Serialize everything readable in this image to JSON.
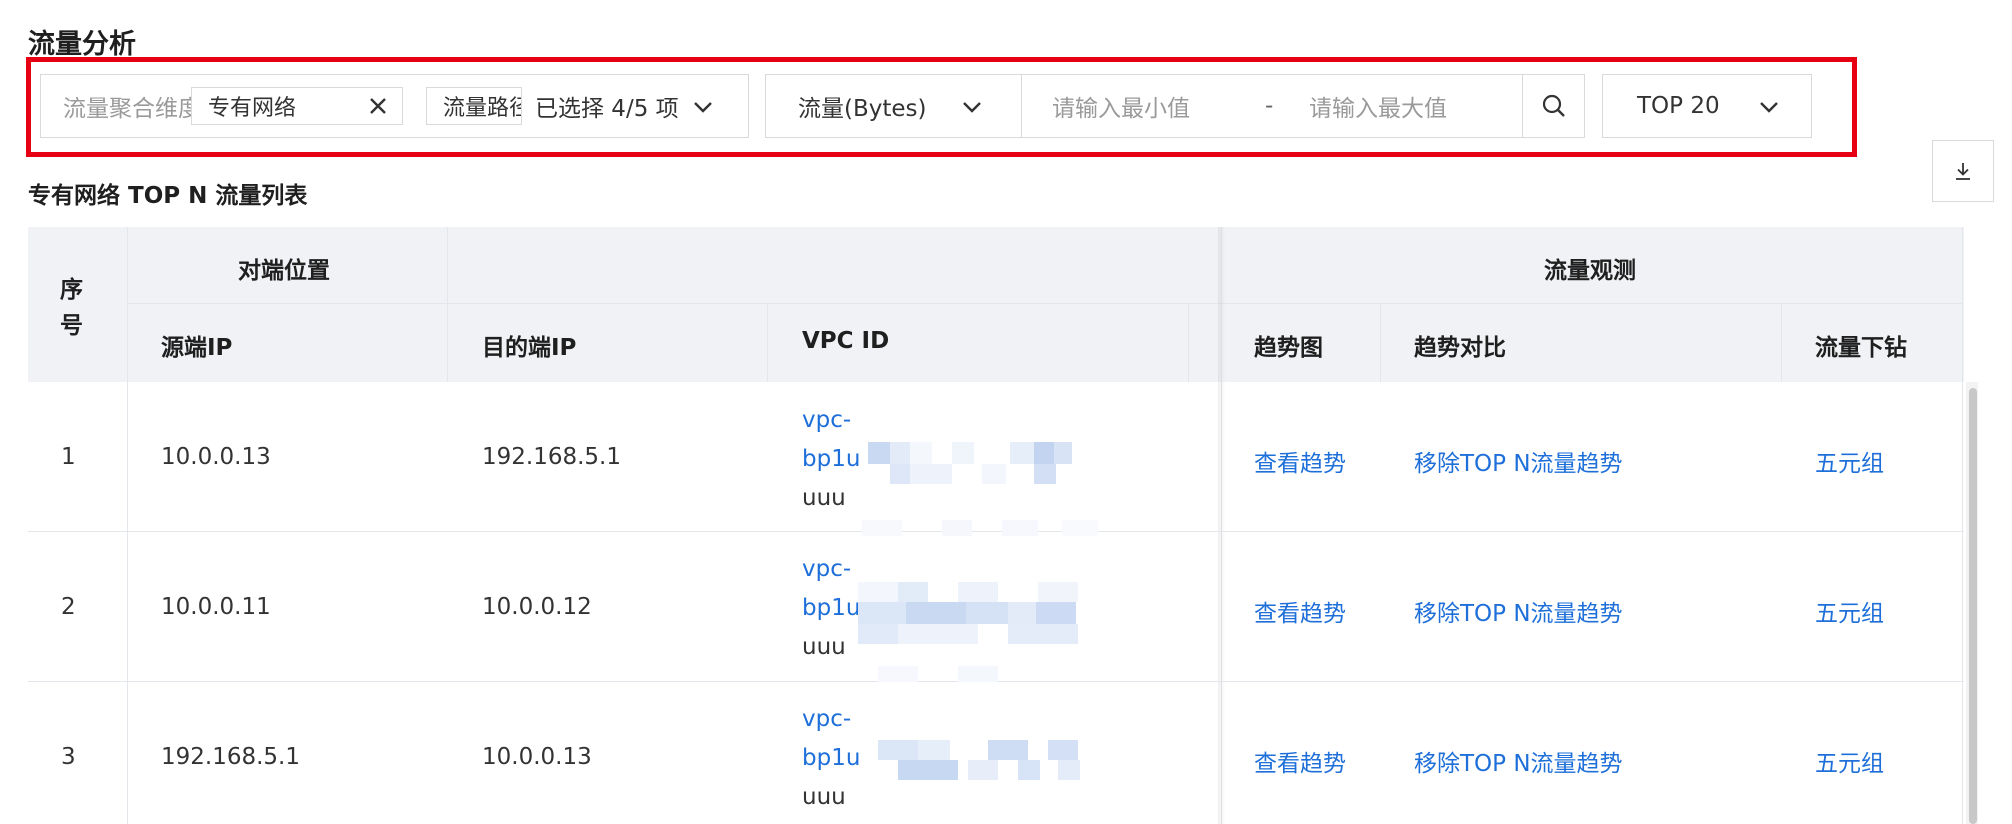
{
  "page": {
    "title": "流量分析"
  },
  "filters": {
    "dimension_label": "流量聚合维度",
    "selected_tags": [
      "专有网络",
      "流量路径"
    ],
    "selected_summary": "已选择 4/5 项",
    "metric": "流量(Bytes)",
    "min_placeholder": "请输入最小值",
    "range_separator": "-",
    "max_placeholder": "请输入最大值",
    "top": "TOP 20"
  },
  "table": {
    "title": "专有网络 TOP N 流量列表",
    "groups": {
      "seq": "序号",
      "peer": "对端位置",
      "flow": "流量观测"
    },
    "columns": [
      "源端IP",
      "目的端IP",
      "VPC ID",
      "趋势图",
      "趋势对比",
      "流量下钻"
    ],
    "rows": [
      {
        "seq": "1",
        "src": "10.0.0.13",
        "dst": "192.168.5.1",
        "vpc_1": "vpc-",
        "vpc_2": "bp1u",
        "vpc_3": "uuu",
        "trend": "查看趋势",
        "compare": "移除TOP N流量趋势",
        "drill": "五元组"
      },
      {
        "seq": "2",
        "src": "10.0.0.11",
        "dst": "10.0.0.12",
        "vpc_1": "vpc-",
        "vpc_2": "bp1u",
        "vpc_3": "uuu",
        "trend": "查看趋势",
        "compare": "移除TOP N流量趋势",
        "drill": "五元组"
      },
      {
        "seq": "3",
        "src": "192.168.5.1",
        "dst": "10.0.0.13",
        "vpc_1": "vpc-",
        "vpc_2": "bp1u",
        "vpc_3": "uuu",
        "trend": "查看趋势",
        "compare": "移除TOP N流量趋势",
        "drill": "五元组"
      }
    ]
  },
  "icons": {
    "tag_close": "close-icon",
    "dropdown": "chevron-down-icon",
    "search": "search-icon",
    "download": "download-icon"
  },
  "colors": {
    "highlight_border": "#e60012",
    "link": "#1e6fd9",
    "header_bg": "#f0f2f5"
  }
}
